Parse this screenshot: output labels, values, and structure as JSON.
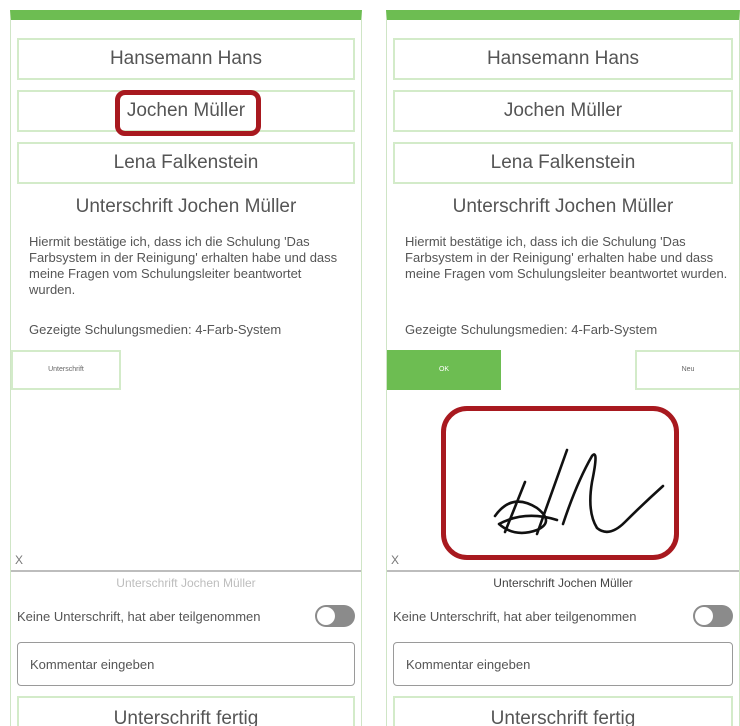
{
  "names": [
    "Hansemann Hans",
    "Jochen Müller",
    "Lena Falkenstein"
  ],
  "signature_title": "Unterschrift Jochen Müller",
  "confirmation_text": "Hiermit bestätige ich, dass ich die Schulung 'Das Farbsystem in der Reinigung' erhalten habe und dass meine Fragen vom Schulungsleiter beantwortet wurden.",
  "media_text": "Gezeigte Schulungsmedien: 4-Farb-System",
  "left": {
    "signature_button": "Unterschrift",
    "sign_line_mark": "X",
    "signature_caption": "Unterschrift Jochen Müller",
    "caption_color": "#bdbdbd"
  },
  "right": {
    "ok_button": "OK",
    "new_button": "Neu",
    "sign_line_mark": "X",
    "signature_caption": "Unterschrift Jochen Müller",
    "caption_color": "#444444"
  },
  "no_signature_label": "Keine Unterschrift, hat aber teilgenommen",
  "no_signature_toggle_on": false,
  "comment_placeholder": "Kommentar eingeben",
  "finish_button": "Unterschrift fertig",
  "colors": {
    "accent": "#6dbd52",
    "highlight": "#a8191f"
  }
}
